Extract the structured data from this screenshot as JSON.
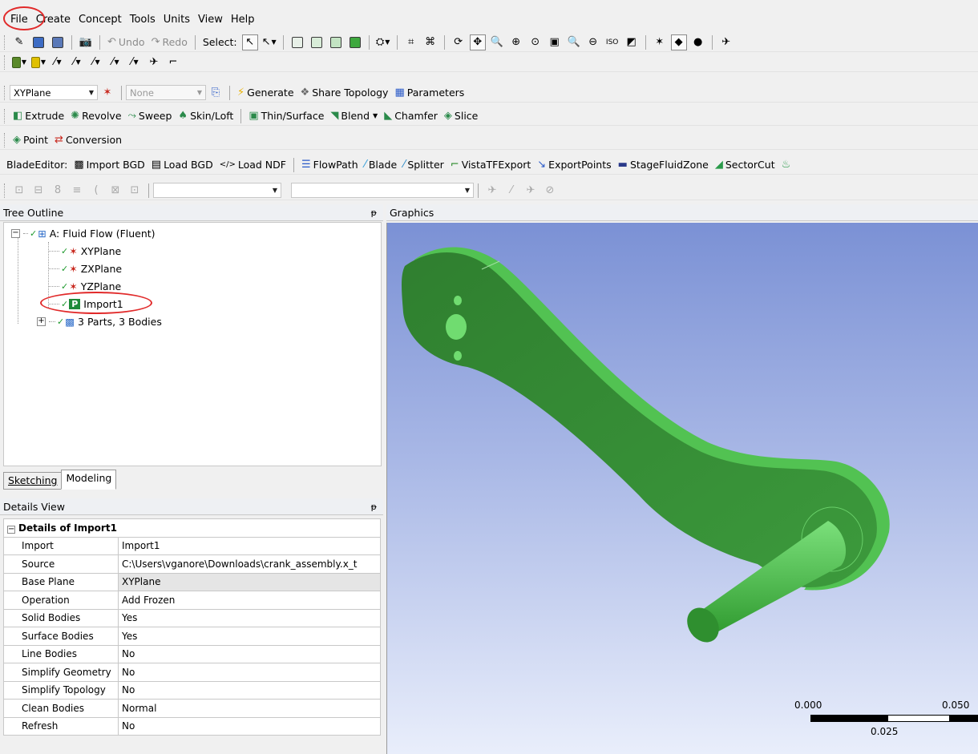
{
  "menu": [
    "File",
    "Create",
    "Concept",
    "Tools",
    "Units",
    "View",
    "Help"
  ],
  "toolbar1": {
    "undo": "Undo",
    "redo": "Redo",
    "select": "Select:"
  },
  "toolbar3": {
    "plane": "XYPlane",
    "sketch": "None",
    "generate": "Generate",
    "share_topology": "Share Topology",
    "parameters": "Parameters"
  },
  "toolbar4": {
    "extrude": "Extrude",
    "revolve": "Revolve",
    "sweep": "Sweep",
    "skin_loft": "Skin/Loft",
    "thin_surface": "Thin/Surface",
    "blend": "Blend",
    "chamfer": "Chamfer",
    "slice": "Slice"
  },
  "toolbar5": {
    "point": "Point",
    "conversion": "Conversion"
  },
  "toolbar6": {
    "label": "BladeEditor:",
    "items": [
      "Import BGD",
      "Load BGD",
      "Load NDF",
      "FlowPath",
      "Blade",
      "Splitter",
      "VistaTFExport",
      "ExportPoints",
      "StageFluidZone",
      "SectorCut"
    ]
  },
  "tree": {
    "title": "Tree Outline",
    "root": "A: Fluid Flow (Fluent)",
    "items": [
      "XYPlane",
      "ZXPlane",
      "YZPlane",
      "Import1"
    ],
    "parts": "3 Parts, 3 Bodies"
  },
  "tabs": [
    "Sketching",
    "Modeling"
  ],
  "details": {
    "title": "Details View",
    "group": "Details of Import1",
    "rows": [
      {
        "name": "Import",
        "value": "Import1"
      },
      {
        "name": "Source",
        "value": "C:\\Users\\vganore\\Downloads\\crank_assembly.x_t"
      },
      {
        "name": "Base Plane",
        "value": "XYPlane"
      },
      {
        "name": "Operation",
        "value": "Add Frozen"
      },
      {
        "name": "Solid Bodies",
        "value": "Yes"
      },
      {
        "name": "Surface Bodies",
        "value": "Yes"
      },
      {
        "name": "Line Bodies",
        "value": "No"
      },
      {
        "name": "Simplify Geometry",
        "value": "No"
      },
      {
        "name": "Simplify Topology",
        "value": "No"
      },
      {
        "name": "Clean Bodies",
        "value": "Normal"
      },
      {
        "name": "Refresh",
        "value": "No"
      }
    ]
  },
  "graphics": {
    "title": "Graphics",
    "scale": [
      "0.000",
      "0.025",
      "0.050"
    ]
  },
  "colors": {
    "model_green": "#3c9a3c",
    "viewport_top": "#7b91d5",
    "annotation_red": "#e12a2a"
  }
}
